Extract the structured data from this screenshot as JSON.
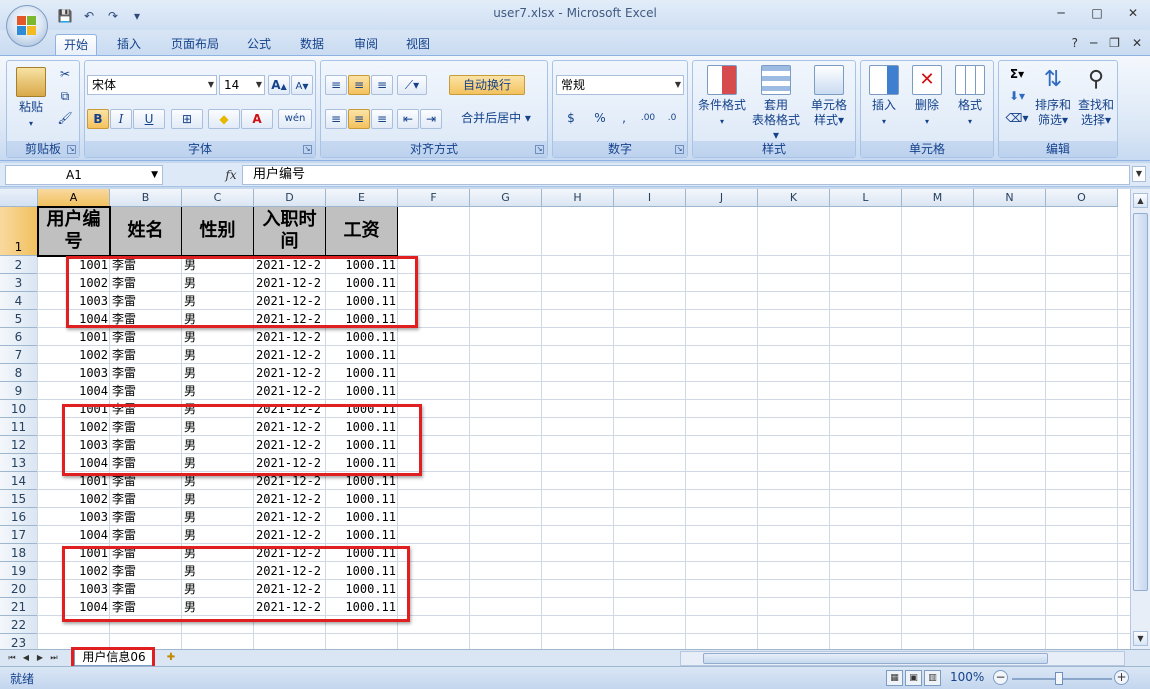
{
  "window": {
    "title": "user7.xlsx - Microsoft Excel",
    "min_glyph": "─",
    "max_glyph": "□",
    "close_glyph": "✕"
  },
  "qat": {
    "save": "💾",
    "undo": "↶",
    "redo": "↷",
    "customize": "▾"
  },
  "tabs": [
    "开始",
    "插入",
    "页面布局",
    "公式",
    "数据",
    "审阅",
    "视图"
  ],
  "tab_right": {
    "help": "?",
    "min": "─",
    "restore": "❐",
    "close": "✕"
  },
  "ribbon": {
    "clipboard": {
      "label": "剪贴板",
      "paste": "粘贴",
      "cut": "✂",
      "copy": "⧉",
      "format_painter": "🖌"
    },
    "font": {
      "label": "字体",
      "name": "宋体",
      "size": "14",
      "grow": "A",
      "shrink": "A",
      "bold": "B",
      "italic": "I",
      "underline": "U",
      "border": "⊞",
      "fill": "◆",
      "font_color": "A",
      "phonetic": "wén"
    },
    "alignment": {
      "label": "对齐方式",
      "wrap": "自动换行",
      "merge": "合并后居中"
    },
    "number": {
      "label": "数字",
      "format": "常规",
      "currency": "$",
      "percent": "%",
      "comma": ",",
      "inc_dec": ".00",
      "dec_dec": ".0"
    },
    "styles": {
      "label": "样式",
      "conditional": "条件格式",
      "table_1": "套用",
      "table_2": "表格格式",
      "cell_styles_1": "单元格",
      "cell_styles_2": "样式"
    },
    "cells": {
      "label": "单元格",
      "insert": "插入",
      "delete": "删除",
      "format": "格式"
    },
    "editing": {
      "label": "编辑",
      "sum": "Σ",
      "sort_1": "排序和",
      "sort_2": "筛选",
      "find_1": "查找和",
      "find_2": "选择"
    }
  },
  "formula_bar": {
    "name_box": "A1",
    "fx": "fx",
    "content": "用户编号"
  },
  "columns": [
    "A",
    "B",
    "C",
    "D",
    "E",
    "F",
    "G",
    "H",
    "I",
    "J",
    "K",
    "L",
    "M",
    "N",
    "O"
  ],
  "row_numbers": [
    "1",
    "2",
    "3",
    "4",
    "5",
    "6",
    "7",
    "8",
    "9",
    "10",
    "11",
    "12",
    "13",
    "14",
    "15",
    "16",
    "17",
    "18",
    "19",
    "20",
    "21",
    "22",
    "23"
  ],
  "headers": [
    "用户编号",
    "姓名",
    "性别",
    "入职时间",
    "工资"
  ],
  "rows": [
    [
      "1001",
      "李雷",
      "男",
      "2021-12-2",
      "1000.11"
    ],
    [
      "1002",
      "李雷",
      "男",
      "2021-12-2",
      "1000.11"
    ],
    [
      "1003",
      "李雷",
      "男",
      "2021-12-2",
      "1000.11"
    ],
    [
      "1004",
      "李雷",
      "男",
      "2021-12-2",
      "1000.11"
    ],
    [
      "1001",
      "李雷",
      "男",
      "2021-12-2",
      "1000.11"
    ],
    [
      "1002",
      "李雷",
      "男",
      "2021-12-2",
      "1000.11"
    ],
    [
      "1003",
      "李雷",
      "男",
      "2021-12-2",
      "1000.11"
    ],
    [
      "1004",
      "李雷",
      "男",
      "2021-12-2",
      "1000.11"
    ],
    [
      "1001",
      "李雷",
      "男",
      "2021-12-2",
      "1000.11"
    ],
    [
      "1002",
      "李雷",
      "男",
      "2021-12-2",
      "1000.11"
    ],
    [
      "1003",
      "李雷",
      "男",
      "2021-12-2",
      "1000.11"
    ],
    [
      "1004",
      "李雷",
      "男",
      "2021-12-2",
      "1000.11"
    ],
    [
      "1001",
      "李雷",
      "男",
      "2021-12-2",
      "1000.11"
    ],
    [
      "1002",
      "李雷",
      "男",
      "2021-12-2",
      "1000.11"
    ],
    [
      "1003",
      "李雷",
      "男",
      "2021-12-2",
      "1000.11"
    ],
    [
      "1004",
      "李雷",
      "男",
      "2021-12-2",
      "1000.11"
    ],
    [
      "1001",
      "李雷",
      "男",
      "2021-12-2",
      "1000.11"
    ],
    [
      "1002",
      "李雷",
      "男",
      "2021-12-2",
      "1000.11"
    ],
    [
      "1003",
      "李雷",
      "男",
      "2021-12-2",
      "1000.11"
    ],
    [
      "1004",
      "李雷",
      "男",
      "2021-12-2",
      "1000.11"
    ]
  ],
  "sheet_tab": "用户信息06",
  "status": {
    "ready": "就绪",
    "zoom": "100%",
    "zoom_out": "−",
    "zoom_in": "+"
  },
  "colors": {
    "highlight_border": "#e02020",
    "header_fill": "#c0c0c0",
    "accent": "#15428b"
  }
}
